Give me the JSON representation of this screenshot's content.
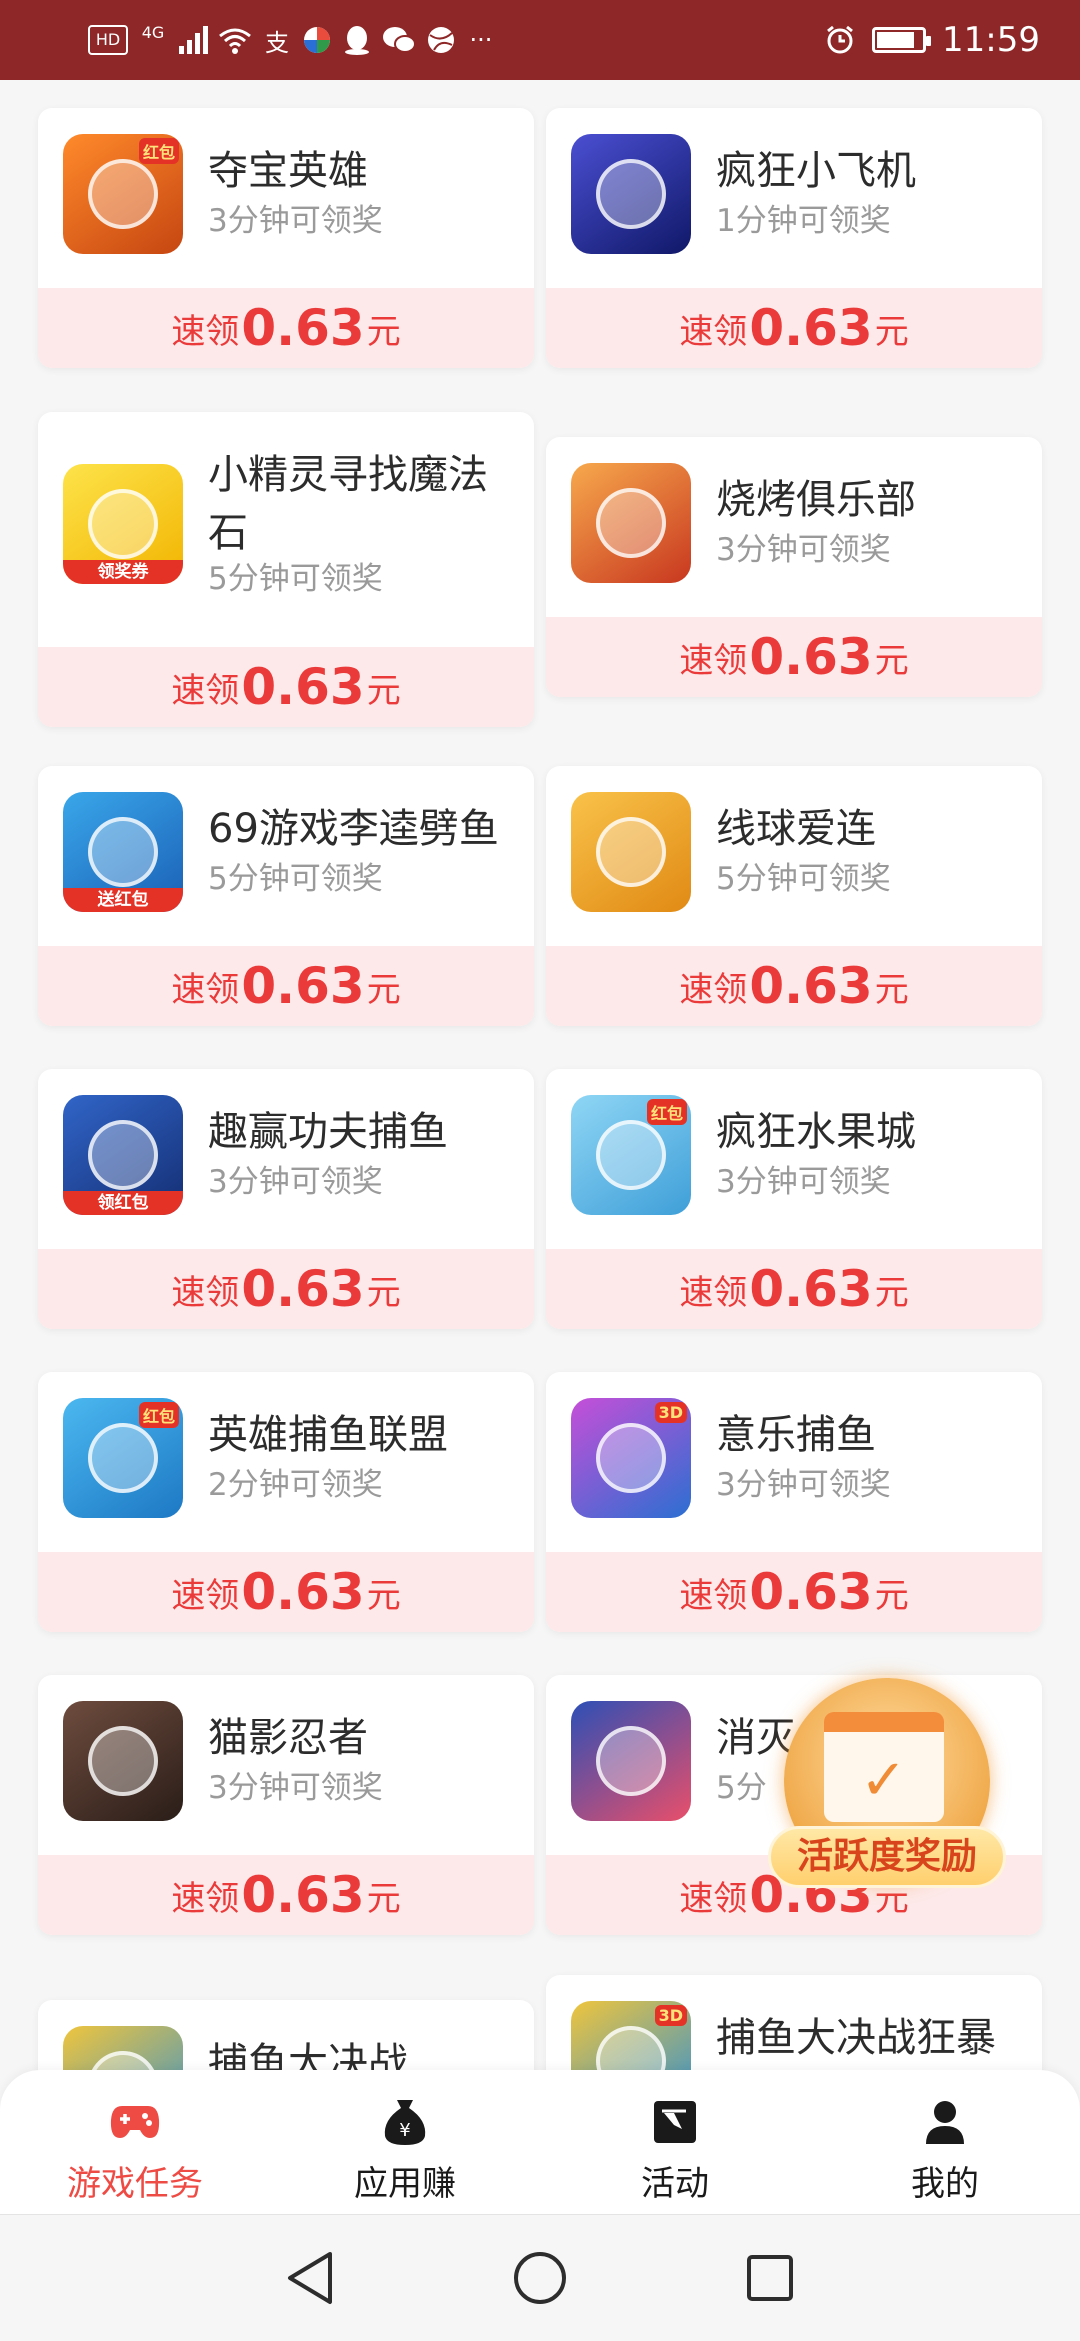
{
  "status_bar": {
    "badge": "HD",
    "network": "4G",
    "time": "11:59",
    "icons": [
      "signal-icon",
      "wifi-icon",
      "alipay-icon",
      "app-icon",
      "qq-icon",
      "wechat-icon",
      "ball-icon",
      "more-icon"
    ],
    "battery_level": 0.85
  },
  "cards": [
    {
      "name": "夺宝英雄",
      "time": "3分钟可领奖",
      "prefix": "速领",
      "amount": "0.63",
      "suffix": "元",
      "icon": "bearded-hero-icon",
      "badge": "红包",
      "colors": [
        "#ff8a2b",
        "#c64611"
      ]
    },
    {
      "name": "疯狂小飞机",
      "time": "1分钟可领奖",
      "prefix": "速领",
      "amount": "0.63",
      "suffix": "元",
      "icon": "airplane-icon",
      "badge": "",
      "colors": [
        "#4b4fd2",
        "#0f1868"
      ]
    },
    {
      "name": "小精灵寻找魔法石",
      "time": "5分钟可领奖",
      "prefix": "速领",
      "amount": "0.63",
      "suffix": "元",
      "icon": "pikachu-icon",
      "badge": "领奖券",
      "colors": [
        "#fde34a",
        "#f2b400"
      ]
    },
    {
      "name": "烧烤俱乐部",
      "time": "3分钟可领奖",
      "prefix": "速领",
      "amount": "0.63",
      "suffix": "元",
      "icon": "pig-icon",
      "badge": "",
      "colors": [
        "#f7a94d",
        "#c8371f"
      ]
    },
    {
      "name": "69游戏李逵劈鱼",
      "time": "5分钟可领奖",
      "prefix": "速领",
      "amount": "0.63",
      "suffix": "元",
      "icon": "shark-cannon-icon",
      "badge": "送红包",
      "colors": [
        "#3aa7ea",
        "#1a5fb5"
      ]
    },
    {
      "name": "线球爱连",
      "time": "5分钟可领奖",
      "prefix": "速领",
      "amount": "0.63",
      "suffix": "元",
      "icon": "cat-icon",
      "badge": "",
      "colors": [
        "#f9c24a",
        "#e08a14"
      ]
    },
    {
      "name": "趣赢功夫捕鱼",
      "time": "3分钟可领奖",
      "prefix": "速领",
      "amount": "0.63",
      "suffix": "元",
      "icon": "shark-icon",
      "badge": "领红包",
      "colors": [
        "#3165c8",
        "#142e73"
      ]
    },
    {
      "name": "疯狂水果城",
      "time": "3分钟可领奖",
      "prefix": "速领",
      "amount": "0.63",
      "suffix": "元",
      "icon": "banana-icon",
      "badge": "红包",
      "colors": [
        "#8fd6f5",
        "#3f9fd8"
      ]
    },
    {
      "name": "英雄捕鱼联盟",
      "time": "2分钟可领奖",
      "prefix": "速领",
      "amount": "0.63",
      "suffix": "元",
      "icon": "fish-robot-icon",
      "badge": "红包",
      "colors": [
        "#4bb8f0",
        "#1d78c4"
      ]
    },
    {
      "name": "意乐捕鱼",
      "time": "3分钟可领奖",
      "prefix": "速领",
      "amount": "0.63",
      "suffix": "元",
      "icon": "monster-icon",
      "badge": "3D",
      "colors": [
        "#c64fd8",
        "#2b6fd1"
      ]
    },
    {
      "name": "猫影忍者",
      "time": "3分钟可领奖",
      "prefix": "速领",
      "amount": "0.63",
      "suffix": "元",
      "icon": "ninja-icon",
      "badge": "",
      "colors": [
        "#6e4c3e",
        "#2a1d18"
      ]
    },
    {
      "name": "消灭",
      "time": "5分",
      "prefix": "速领",
      "amount": "0.63",
      "suffix": "元",
      "icon": "apple-face-icon",
      "badge": "",
      "colors": [
        "#2c4fb6",
        "#e94f6a"
      ]
    },
    {
      "name": "捕鱼大决战",
      "time": "",
      "prefix": "",
      "amount": "",
      "suffix": "",
      "icon": "fish-battle-icon",
      "badge": "",
      "colors": [
        "#f0c53c",
        "#2c8fd6"
      ]
    },
    {
      "name": "捕鱼大决战狂暴",
      "time": "",
      "prefix": "",
      "amount": "",
      "suffix": "",
      "icon": "fish-battle-3d-icon",
      "badge": "3D",
      "colors": [
        "#f0c53c",
        "#2c8fd6"
      ]
    }
  ],
  "floating_reward": {
    "label": "活跃度奖励",
    "icon": "calendar-check-icon"
  },
  "tabs": [
    {
      "label": "游戏任务",
      "icon": "gamepad-icon",
      "active": true
    },
    {
      "label": "应用赚",
      "icon": "money-bag-icon",
      "active": false
    },
    {
      "label": "活动",
      "icon": "activity-icon",
      "active": false
    },
    {
      "label": "我的",
      "icon": "user-icon",
      "active": false
    }
  ],
  "nav": [
    "back-icon",
    "home-icon",
    "recents-icon"
  ],
  "colors": {
    "status_bg": "#8e2727",
    "accent": "#ea3a3a",
    "card_bottom": "#fde9e9",
    "tab_active": "#ef4b45"
  }
}
